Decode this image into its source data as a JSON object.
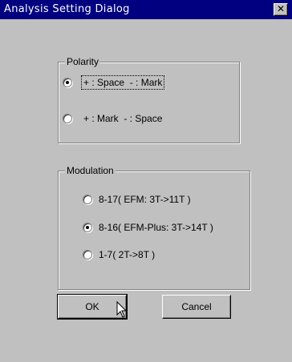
{
  "window": {
    "title": "Analysis Setting Dialog",
    "close_glyph": "✕"
  },
  "polarity": {
    "label": "Polarity",
    "options": [
      {
        "label": "+ : Space  - : Mark",
        "selected": true
      },
      {
        "label": "+ : Mark  - : Space",
        "selected": false
      }
    ]
  },
  "modulation": {
    "label": "Modulation",
    "options": [
      {
        "label": "8-17( EFM: 3T->11T )",
        "selected": false
      },
      {
        "label": "8-16( EFM-Plus: 3T->14T )",
        "selected": true
      },
      {
        "label": "1-7( 2T->8T )",
        "selected": false
      }
    ]
  },
  "buttons": {
    "ok": "OK",
    "cancel": "Cancel"
  },
  "icons": {
    "close": "close-icon",
    "cursor": "mouse-pointer-icon",
    "radio_selected": "radio-selected-icon",
    "radio_unselected": "radio-unselected-icon"
  },
  "colors": {
    "titlebar": "#000080",
    "face": "#c0c0c0"
  }
}
